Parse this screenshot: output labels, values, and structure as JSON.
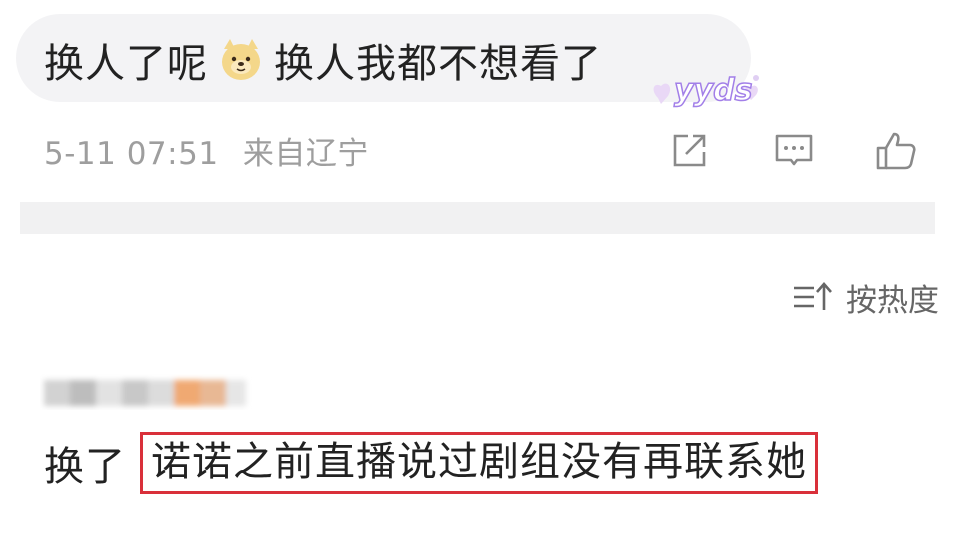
{
  "comment1": {
    "text_before": "换人了呢",
    "emoji": "dog-emoji",
    "text_after": "换人我都不想看了",
    "sticker": "yyds"
  },
  "meta": {
    "datetime": "5-11 07:51",
    "location": "来自辽宁"
  },
  "actions": {
    "share_icon": "share-icon",
    "comment_icon": "comment-icon",
    "like_icon": "thumbs-up-icon"
  },
  "sort": {
    "label": "按热度",
    "icon": "sort-icon"
  },
  "reply": {
    "prefix": "换了",
    "highlighted": "诺诺之前直播说过剧组没有再联系她"
  },
  "colors": {
    "highlight_border": "#d9303a",
    "meta_gray": "#9e9e9e",
    "sticker_purple": "#a27fe8"
  }
}
